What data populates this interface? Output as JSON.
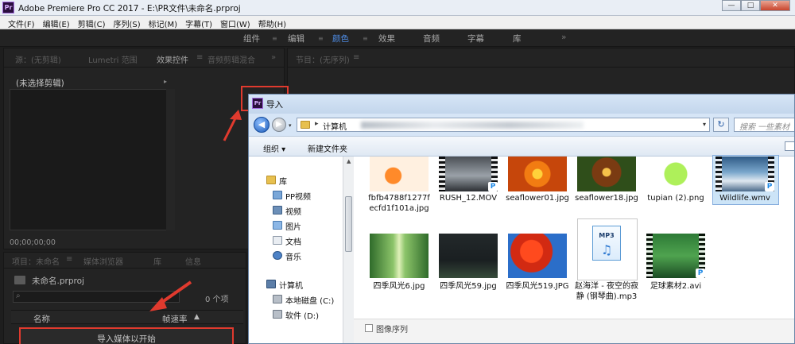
{
  "app": {
    "title": "Adobe Premiere Pro CC 2017 - E:\\PR文件\\未命名.prproj",
    "logo": "Pr",
    "window_buttons": [
      "—",
      "□",
      "✕"
    ]
  },
  "menu": [
    "文件(F)",
    "编辑(E)",
    "剪辑(C)",
    "序列(S)",
    "标记(M)",
    "字幕(T)",
    "窗口(W)",
    "帮助(H)"
  ],
  "workspaces": {
    "tabs": [
      "组件",
      "编辑",
      "颜色",
      "效果",
      "音频",
      "字幕",
      "库"
    ],
    "active": "颜色",
    "overflow": "»"
  },
  "source_panel": {
    "tabs": [
      "源：(无剪辑)",
      "Lumetri 范围",
      "效果控件",
      "音频剪辑混合"
    ],
    "active_tab": "效果控件",
    "menu_icon": "≡",
    "overflow": "»",
    "clip_label": "(未选择剪辑)",
    "timecode": "00;00;00;00"
  },
  "program_panel": {
    "tabs": [
      "节目：(无序列)"
    ],
    "menu_icon": "≡"
  },
  "project_panel": {
    "tabs": [
      "项目：未命名",
      "媒体浏览器",
      "库",
      "信息"
    ],
    "menu_icon": "≡",
    "file": "未命名.prproj",
    "count": "0 个项",
    "columns": {
      "name": "名称",
      "rate": "帧速率"
    },
    "sort_arrow": "▲",
    "drop_text": "导入媒体以开始"
  },
  "import_dialog": {
    "title": "导入",
    "logo": "Pr",
    "address": {
      "root": "计算机",
      "arrow": "▸",
      "dropdown": "▾"
    },
    "search_placeholder": "搜索 一些素材",
    "toolbar": {
      "organize": "组织 ▾",
      "new_folder": "新建文件夹"
    },
    "nav": {
      "library": "库",
      "items": [
        "PP视频",
        "视频",
        "图片",
        "文档",
        "音乐"
      ],
      "computer": "计算机",
      "drives": [
        "本地磁盘 (C:)",
        "软件 (D:)"
      ]
    },
    "files_row1": [
      {
        "name": "fbfb4788f1277fecfd1f101a.jpg",
        "thumb": "flower-white"
      },
      {
        "name": "RUSH_12.MOV",
        "thumb": "road-video"
      },
      {
        "name": "seaflower01.jpg",
        "thumb": "orange-flower"
      },
      {
        "name": "seaflower18.jpg",
        "thumb": "brown-flower"
      },
      {
        "name": "tupian (2).png",
        "thumb": "green-toy"
      },
      {
        "name": "Wildlife.wmv",
        "thumb": "whale-video",
        "selected": true
      }
    ],
    "files_row2": [
      {
        "name": "四季风光6.jpg",
        "thumb": "forest"
      },
      {
        "name": "四季风光59.jpg",
        "thumb": "dark-landscape"
      },
      {
        "name": "四季风光519.JPG",
        "thumb": "autumn-tree"
      },
      {
        "name": "赵海洋 - 夜空的寂静 (钢琴曲).mp3",
        "thumb": "mp3-icon"
      },
      {
        "name": "足球素材2.avi",
        "thumb": "soccer-video"
      }
    ],
    "mp3_badge": "MP3",
    "mp3_note": "♫",
    "video_badge": "P",
    "sequence_label": "图像序列"
  },
  "colors": {
    "accent": "#4f8ee8",
    "annotation": "#e03a2e"
  }
}
